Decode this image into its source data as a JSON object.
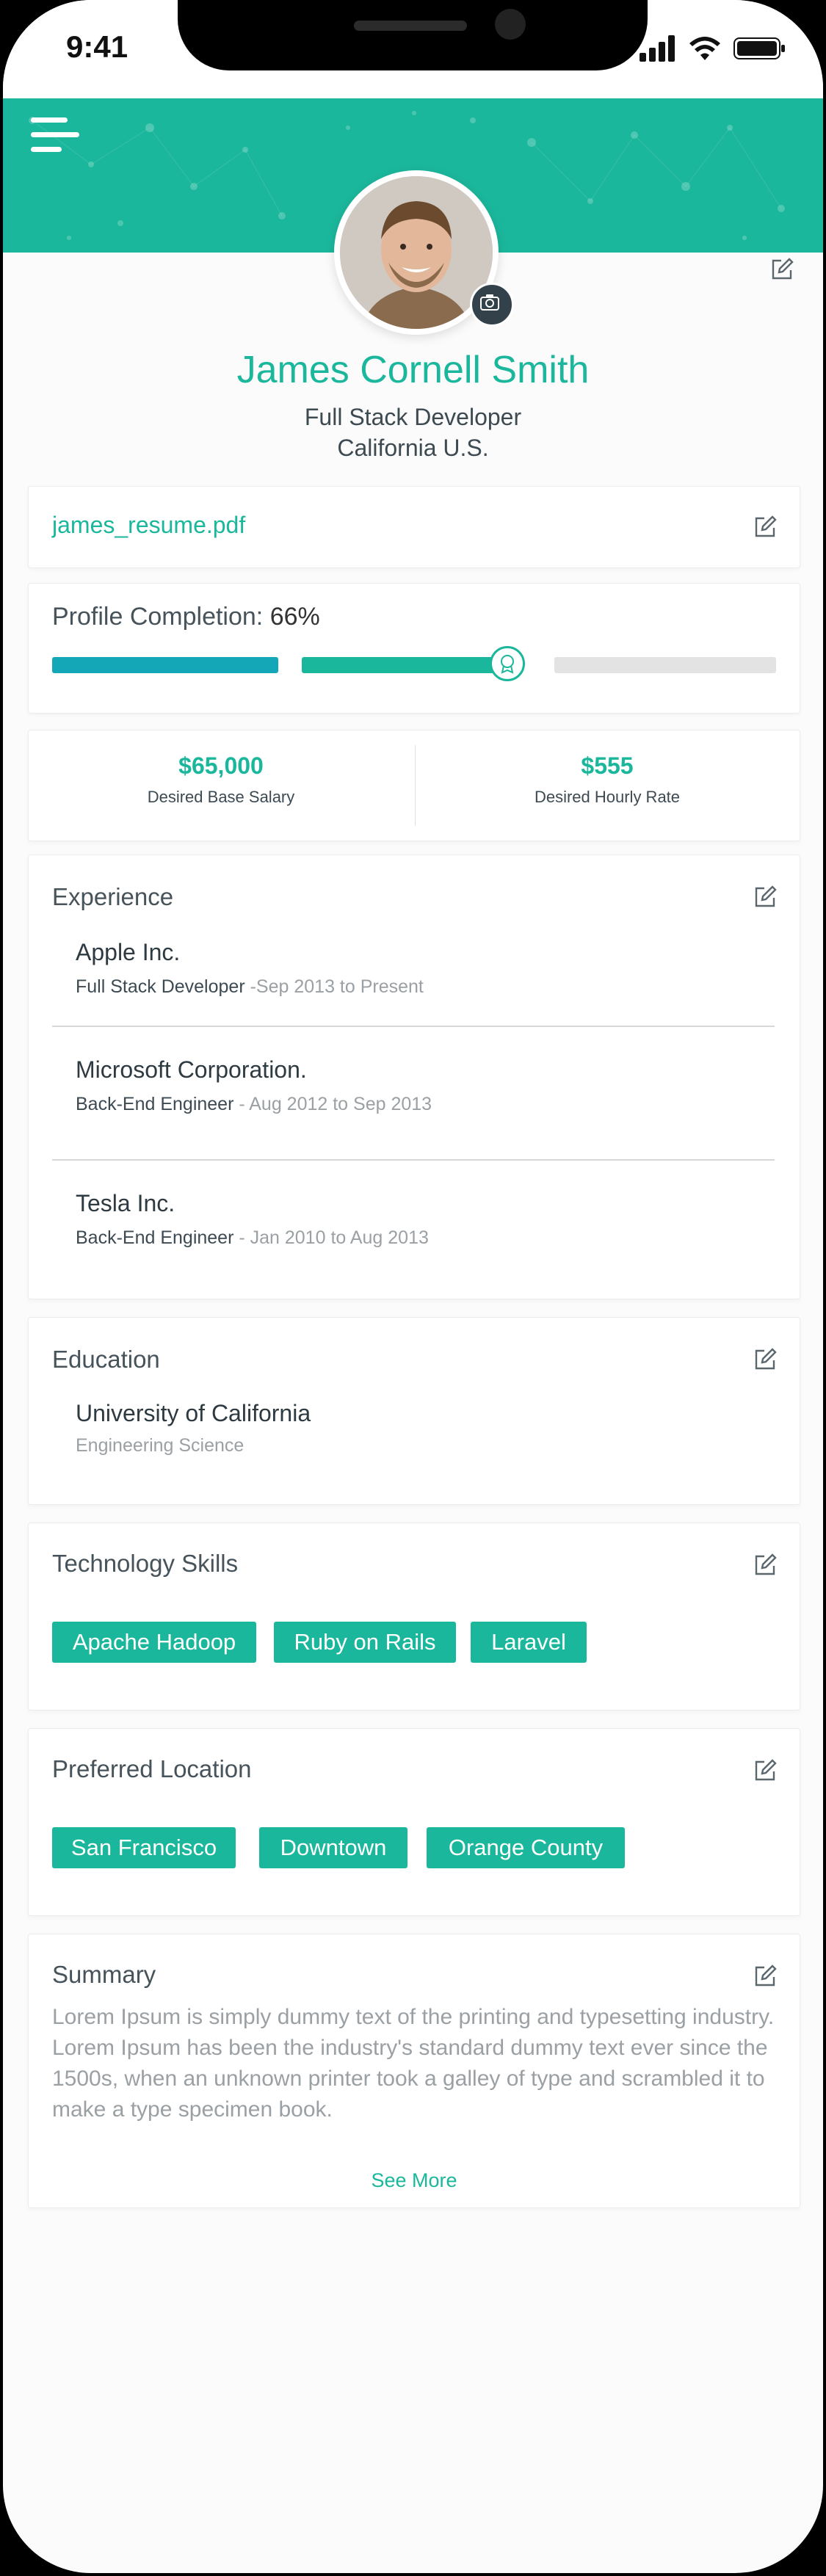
{
  "status_bar": {
    "time": "9:41"
  },
  "profile": {
    "name": "James Cornell Smith",
    "title": "Full Stack Developer",
    "location": "California U.S."
  },
  "resume": {
    "filename": "james_resume.pdf"
  },
  "completion": {
    "label": "Profile Completion:",
    "value": "66%",
    "fraction": 0.66
  },
  "salary": {
    "base_value": "$65,000",
    "base_label": "Desired Base Salary",
    "hourly_value": "$555",
    "hourly_label": "Desired Hourly Rate"
  },
  "experience": {
    "title": "Experience",
    "items": [
      {
        "company": "Apple Inc.",
        "role": "Full Stack Developer",
        "dates": " -Sep 2013 to Present"
      },
      {
        "company": "Microsoft Corporation.",
        "role": "Back-End Engineer",
        "dates": " - Aug 2012 to Sep 2013"
      },
      {
        "company": "Tesla Inc.",
        "role": "Back-End Engineer",
        "dates": " - Jan 2010 to Aug 2013"
      }
    ]
  },
  "education": {
    "title": "Education",
    "school": "University of California",
    "field": "Engineering Science"
  },
  "skills": {
    "title": "Technology Skills",
    "items": [
      "Apache Hadoop",
      "Ruby on Rails",
      "Laravel"
    ]
  },
  "locations": {
    "title": "Preferred Location",
    "items": [
      "San Francisco",
      "Downtown",
      "Orange County"
    ]
  },
  "summary": {
    "title": "Summary",
    "text": "Lorem Ipsum is simply dummy text of the printing and typesetting industry. Lorem Ipsum has been the industry's standard dummy text ever since the 1500s, when an unknown printer took a galley of type and scrambled it to make a type specimen book.",
    "see_more": "See More"
  },
  "colors": {
    "accent": "#1bb79c",
    "progress_done": "#14a7b8",
    "progress_empty": "#e3e3e3"
  },
  "icons": [
    "menu-icon",
    "camera-icon",
    "edit-icon",
    "badge-icon",
    "signal-icon",
    "wifi-icon",
    "battery-icon"
  ]
}
